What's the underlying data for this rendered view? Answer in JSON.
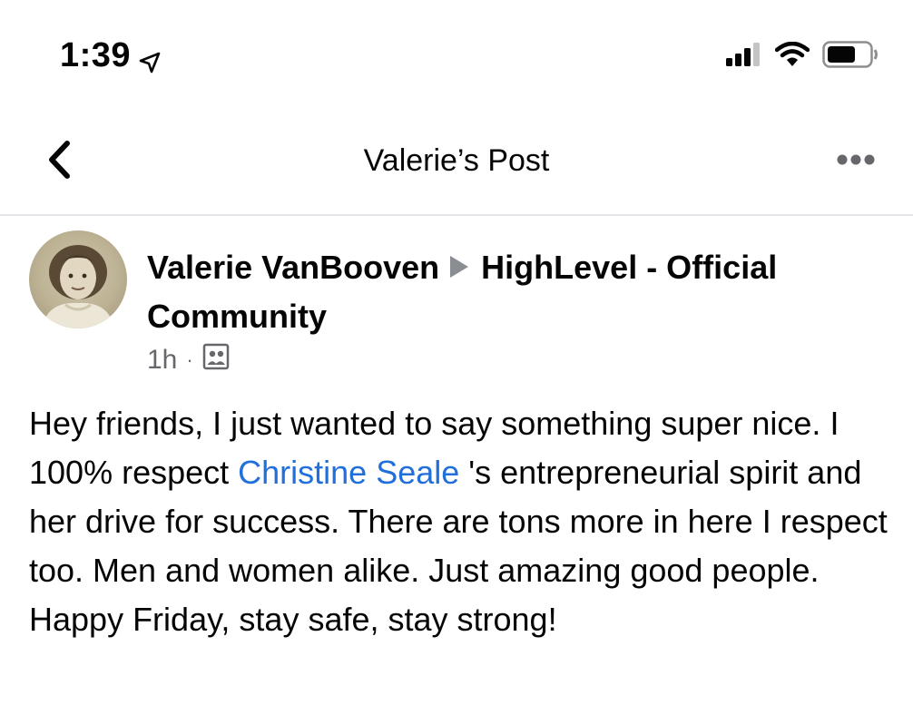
{
  "status_bar": {
    "time": "1:39",
    "icons": [
      "location-arrow-icon",
      "cellular-signal-icon",
      "wifi-icon",
      "battery-icon"
    ]
  },
  "nav": {
    "title": "Valerie’s Post",
    "back_icon": "chevron-left-icon",
    "more_icon": "more-dots-icon"
  },
  "post": {
    "author": "Valerie VanBooven",
    "group": "HighLevel - Official Community",
    "time_ago": "1h",
    "separator": "·",
    "audience_icon": "group-members-icon",
    "body_before": "Hey friends, I just wanted to say something super nice. I 100% respect ",
    "mention": "Christine Seale",
    "body_after": " 's entrepreneurial spirit and her drive for success. There are tons more in here I respect too. Men and women alike. Just amazing good people. Happy Friday, stay safe, stay strong!"
  },
  "colors": {
    "mention": "#216fdb",
    "meta_text": "#65676b",
    "divider": "#e4e6eb"
  }
}
